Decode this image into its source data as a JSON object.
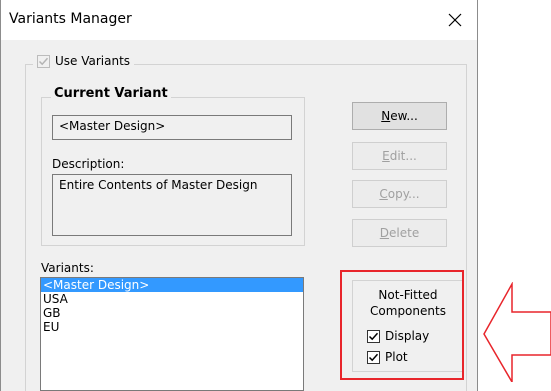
{
  "window": {
    "title": "Variants Manager",
    "close_icon": "close-icon"
  },
  "use_variants": {
    "label": "Use Variants",
    "checked": true,
    "enabled": false
  },
  "current_variant": {
    "group_label": "Current Variant",
    "name": "<Master Design>",
    "description_label": "Description:",
    "description": "Entire Contents of Master Design"
  },
  "buttons": {
    "new": {
      "prefix": "",
      "mnemonic": "N",
      "rest": "ew...",
      "enabled": true
    },
    "edit": {
      "prefix": "",
      "mnemonic": "E",
      "rest": "dit...",
      "enabled": false
    },
    "copy": {
      "prefix": "",
      "mnemonic": "C",
      "rest": "opy...",
      "enabled": false
    },
    "delete": {
      "prefix": "",
      "mnemonic": "D",
      "rest": "elete",
      "enabled": false
    }
  },
  "variants": {
    "label": "Variants:",
    "items": [
      "<Master Design>",
      "USA",
      "GB",
      "EU"
    ],
    "selected_index": 0
  },
  "not_fitted": {
    "title_line1": "Not-Fitted",
    "title_line2": "Components",
    "display_label": "Display",
    "display_checked": true,
    "plot_label": "Plot",
    "plot_checked": true
  },
  "annotation": {
    "highlight_color": "#e8252b",
    "arrow_icon": "arrow-left-icon"
  }
}
